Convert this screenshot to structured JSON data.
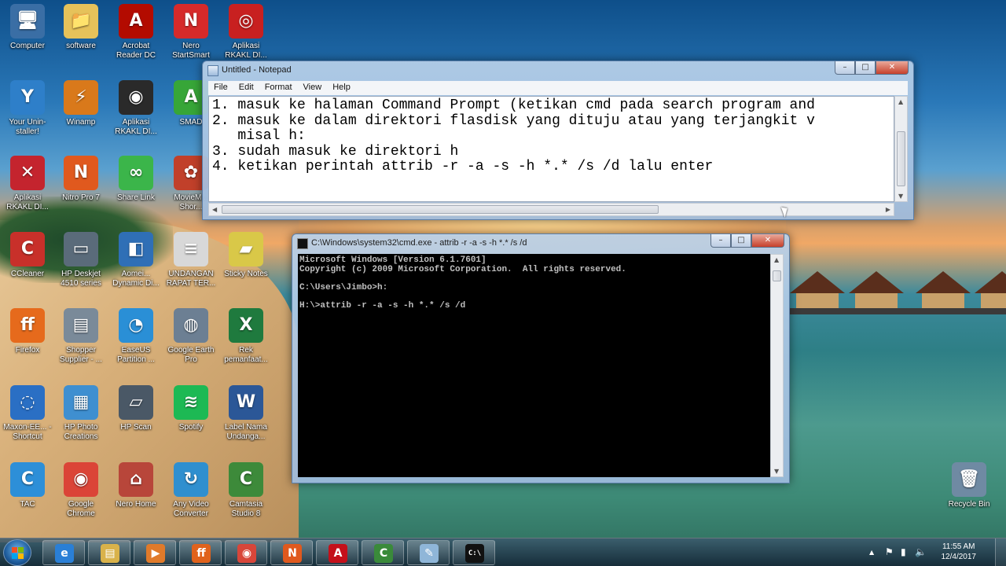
{
  "desktop": {
    "icons": [
      {
        "label": "Computer",
        "glyph": "🖥",
        "bg": "#3a6ea5"
      },
      {
        "label": "software",
        "glyph": "📁",
        "bg": "#e6c25a"
      },
      {
        "label": "Acrobat Reader DC",
        "glyph": "A",
        "bg": "#b30b00"
      },
      {
        "label": "Nero StartSmart",
        "glyph": "N",
        "bg": "#d62a2a"
      },
      {
        "label": "Aplikasi RKAKL DI...",
        "glyph": "◎",
        "bg": "#c82020"
      },
      {
        "label": "Your Unin-staller!",
        "glyph": "Y",
        "bg": "#2e7fc9"
      },
      {
        "label": "Winamp",
        "glyph": "⚡",
        "bg": "#d9791b"
      },
      {
        "label": "Aplikasi RKAKL DI...",
        "glyph": "◉",
        "bg": "#2a2a2a"
      },
      {
        "label": "SMAD",
        "glyph": "A",
        "bg": "#37a638"
      },
      {
        "label": "Aplikasi RKAKL DI...",
        "glyph": "✕",
        "bg": "#c4242e"
      },
      {
        "label": "Nitro Pro 7",
        "glyph": "N",
        "bg": "#e0591e"
      },
      {
        "label": "Share Link",
        "glyph": "∞",
        "bg": "#3bb54a"
      },
      {
        "label": "MovieM... Shor...",
        "glyph": "✿",
        "bg": "#c1402a"
      },
      {
        "label": "CCleaner",
        "glyph": "C",
        "bg": "#c8302a"
      },
      {
        "label": "HP Deskjet 4510 series",
        "glyph": "▭",
        "bg": "#5a6b7a"
      },
      {
        "label": "Aomei... Dynamic Di...",
        "glyph": "◧",
        "bg": "#2f6fb6"
      },
      {
        "label": "UNDANGAN RAPAT TER...",
        "glyph": "≡",
        "bg": "#d8d8d8"
      },
      {
        "label": "Sticky Notes",
        "glyph": "▰",
        "bg": "#d9c848"
      },
      {
        "label": "Firefox",
        "glyph": "ff",
        "bg": "#e66a1c"
      },
      {
        "label": "Shopper Supplier - ...",
        "glyph": "▤",
        "bg": "#7a8a99"
      },
      {
        "label": "EaseUS Partition ...",
        "glyph": "◔",
        "bg": "#2a8fd6"
      },
      {
        "label": "Google Earth Pro",
        "glyph": "◍",
        "bg": "#6c7f93"
      },
      {
        "label": "Rek pemanfaat...",
        "glyph": "X",
        "bg": "#1f7a3e"
      },
      {
        "label": "Maxon-EE... - Shortcut",
        "glyph": "◌",
        "bg": "#2a6fc4"
      },
      {
        "label": "HP Photo Creations",
        "glyph": "▦",
        "bg": "#3f8fd0"
      },
      {
        "label": "HP Scan",
        "glyph": "▱",
        "bg": "#4a5866"
      },
      {
        "label": "Spotify",
        "glyph": "≋",
        "bg": "#1db954"
      },
      {
        "label": "Label Nama Undanga...",
        "glyph": "W",
        "bg": "#2b5797"
      },
      {
        "label": "TAC",
        "glyph": "C",
        "bg": "#2d8fd8"
      },
      {
        "label": "Google Chrome",
        "glyph": "◉",
        "bg": "#db4437"
      },
      {
        "label": "Nero Home",
        "glyph": "⌂",
        "bg": "#b8463a"
      },
      {
        "label": "Any Video Converter",
        "glyph": "↻",
        "bg": "#2f8fcf"
      },
      {
        "label": "Camtasia Studio 8",
        "glyph": "C",
        "bg": "#3d8a3a"
      },
      {
        "label": "Recycle Bin",
        "glyph": "🗑",
        "bg": "#6f8aa3"
      }
    ]
  },
  "notepad": {
    "title": "Untitled - Notepad",
    "menu": [
      "File",
      "Edit",
      "Format",
      "View",
      "Help"
    ],
    "lines": [
      "1. masuk ke halaman Command Prompt (ketikan cmd pada search program and",
      "2. masuk ke dalam direktori flasdisk yang dituju atau yang terjangkit v",
      "   misal h:",
      "3. sudah masuk ke direktori h",
      "4. ketikan perintah attrib -r -a -s -h *.* /s /d lalu enter"
    ],
    "controls": {
      "min": "–",
      "max": "□",
      "close": "✕"
    }
  },
  "cmd": {
    "title": "C:\\Windows\\system32\\cmd.exe - attrib  -r -a -s -h *.* /s /d",
    "lines": [
      "Microsoft Windows [Version 6.1.7601]",
      "Copyright (c) 2009 Microsoft Corporation.  All rights reserved.",
      "",
      "C:\\Users\\Jimbo>h:",
      "",
      "H:\\>attrib -r -a -s -h *.* /s /d"
    ],
    "controls": {
      "min": "–",
      "max": "□",
      "close": "✕"
    }
  },
  "taskbar": {
    "apps": [
      {
        "name": "internet-explorer",
        "glyph": "e",
        "bg": "#2a7fd6"
      },
      {
        "name": "windows-explorer",
        "glyph": "▤",
        "bg": "#d9b24a"
      },
      {
        "name": "media-player",
        "glyph": "▶",
        "bg": "#e07a2a"
      },
      {
        "name": "firefox",
        "glyph": "ff",
        "bg": "#e0621c"
      },
      {
        "name": "chrome",
        "glyph": "◉",
        "bg": "#d8463a"
      },
      {
        "name": "nitro-pro",
        "glyph": "N",
        "bg": "#e0591e"
      },
      {
        "name": "acrobat",
        "glyph": "A",
        "bg": "#c4101a"
      },
      {
        "name": "camtasia",
        "glyph": "C",
        "bg": "#3a8a3a"
      },
      {
        "name": "notepad",
        "glyph": "✎",
        "bg": "#8fb6d8"
      },
      {
        "name": "cmd",
        "glyph": "C:\\",
        "bg": "#111111"
      }
    ],
    "tray": {
      "time": "11:55 AM",
      "date": "12/4/2017",
      "up_arrow": "▲",
      "flag": "⚑",
      "network": "▮",
      "volume": "🔈"
    }
  }
}
